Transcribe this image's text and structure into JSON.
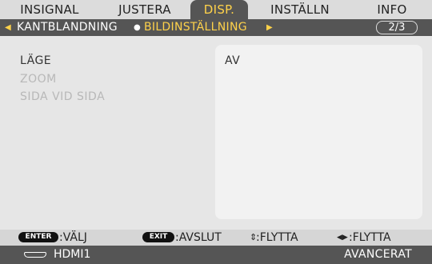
{
  "tabs": [
    {
      "label": "INSIGNAL",
      "active": false
    },
    {
      "label": "JUSTERA",
      "active": false
    },
    {
      "label": "DISP.",
      "active": true
    },
    {
      "label": "INSTÄLLN",
      "active": false
    },
    {
      "label": "INFO",
      "active": false
    }
  ],
  "subnav": {
    "prev_item": "KANTBLANDNING",
    "current_item": "BILDINSTÄLLNING",
    "page": "2/3"
  },
  "settings": {
    "items": [
      {
        "label": "LÄGE",
        "enabled": true
      },
      {
        "label": "ZOOM",
        "enabled": false
      },
      {
        "label": "SIDA VID SIDA",
        "enabled": false
      }
    ],
    "value": "AV"
  },
  "help": {
    "enter_key": "ENTER",
    "enter_text": ":VÄLJ",
    "exit_key": "EXIT",
    "exit_text": ":AVSLUT",
    "updown_text": ":FLYTTA",
    "leftright_text": ":FLYTTA"
  },
  "status": {
    "source": "HDMI1",
    "mode": "AVANCERAT"
  },
  "colors": {
    "active_tab_text": "#ffd24a",
    "bar_dark": "#555555",
    "background": "#e6e6e6"
  }
}
